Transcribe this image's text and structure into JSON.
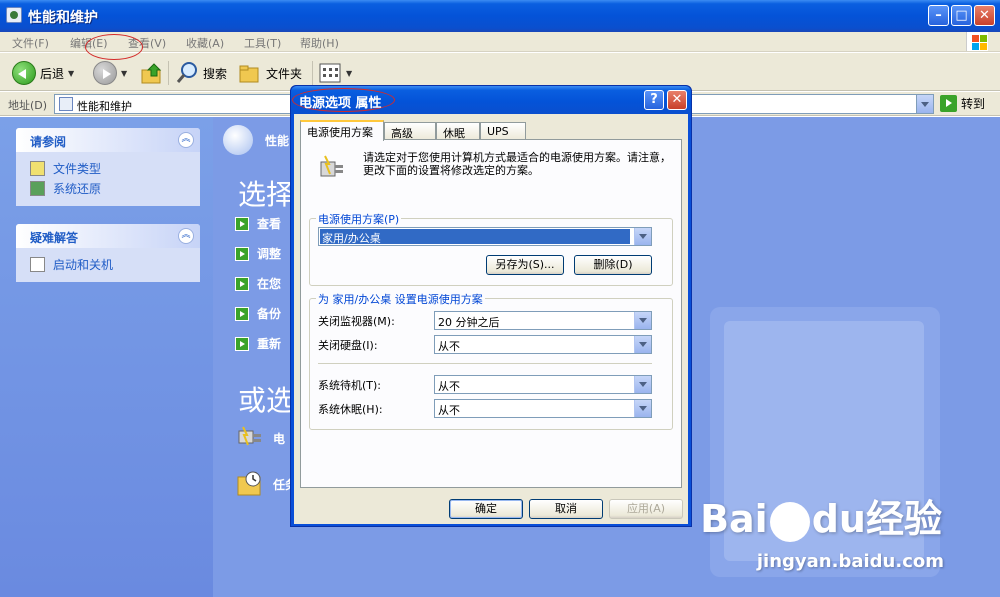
{
  "window": {
    "title": "性能和维护",
    "menu": [
      "文件(F)",
      "编辑(E)",
      "查看(V)",
      "收藏(A)",
      "工具(T)",
      "帮助(H)"
    ],
    "toolbar": {
      "back": "后退",
      "search": "搜索",
      "folders": "文件夹"
    },
    "address": {
      "label": "地址(D)",
      "value": "性能和维护",
      "go": "转到"
    }
  },
  "sidebar": {
    "see_also": {
      "title": "请参阅",
      "items": [
        "文件类型",
        "系统还原"
      ]
    },
    "troubleshoot": {
      "title": "疑难解答",
      "items": [
        "启动和关机"
      ]
    }
  },
  "main": {
    "header": "性能",
    "pick_title": "选择",
    "tasks": [
      "查看",
      "调整",
      "在您",
      "备份",
      "重新"
    ],
    "or_title": "或选",
    "cpl_items": [
      "电",
      "任务"
    ]
  },
  "dialog": {
    "title": "电源选项 属性",
    "tabs": [
      "电源使用方案",
      "高级",
      "休眠",
      "UPS"
    ],
    "intro": "请选定对于您使用计算机方式最适合的电源使用方案。请注意，更改下面的设置将修改选定的方案。",
    "scheme_group": {
      "label": "电源使用方案(P)",
      "selected": "家用/办公桌",
      "save_as": "另存为(S)...",
      "delete": "删除(D)"
    },
    "settings_group": {
      "label": "为 家用/办公桌 设置电源使用方案",
      "rows": [
        {
          "label": "关闭监视器(M):",
          "value": "20 分钟之后"
        },
        {
          "label": "关闭硬盘(I):",
          "value": "从不"
        },
        {
          "label": "系统待机(T):",
          "value": "从不"
        },
        {
          "label": "系统休眠(H):",
          "value": "从不"
        }
      ]
    },
    "buttons": {
      "ok": "确定",
      "cancel": "取消",
      "apply": "应用(A)"
    }
  },
  "watermark": {
    "brand": "Bai",
    "brand2": "du",
    "brand3": "经验",
    "url": "jingyan.baidu.com"
  }
}
